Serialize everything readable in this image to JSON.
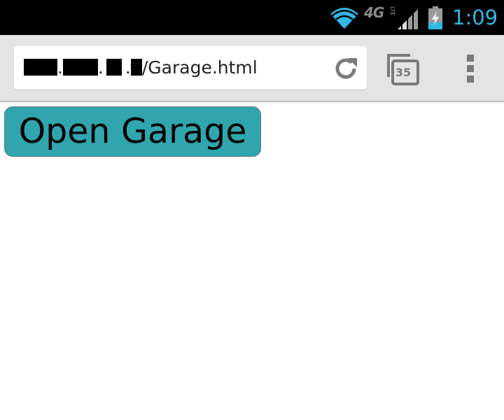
{
  "status_bar": {
    "time": "1:09",
    "network_type": "4G",
    "network_subtype": "LTE",
    "icons": [
      "wifi-icon",
      "signal-icon",
      "battery-charging-icon"
    ],
    "clock_color": "#33b5e5"
  },
  "browser": {
    "url_path": "/Garage.html",
    "tab_count": "35",
    "icons": [
      "reload-icon",
      "tabs-icon",
      "overflow-menu-icon"
    ]
  },
  "page": {
    "button_label": "Open Garage",
    "button_color": "#31a5ae"
  }
}
